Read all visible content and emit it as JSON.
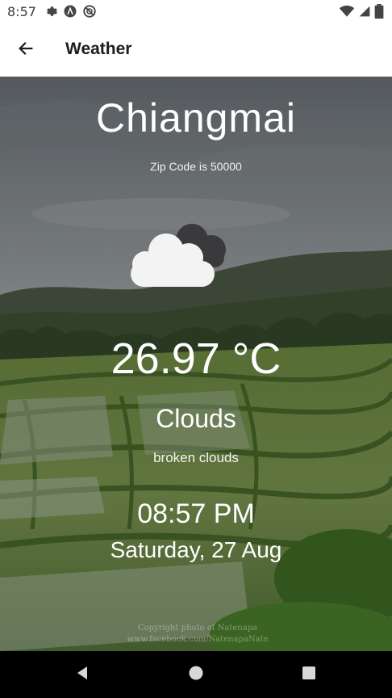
{
  "status_bar": {
    "time": "8:57",
    "left_icons": [
      "settings-icon",
      "a-badge-icon",
      "do-not-disturb-icon"
    ],
    "right_icons": [
      "wifi-icon",
      "cell-signal-icon",
      "battery-icon"
    ]
  },
  "app_bar": {
    "title": "Weather",
    "back_icon": "arrow-back-icon"
  },
  "weather": {
    "city": "Chiangmai",
    "zip_label": "Zip Code is 50000",
    "icon": "broken-clouds-icon",
    "temperature": "26.97 °C",
    "condition": "Clouds",
    "description": "broken clouds",
    "time": "08:57 PM",
    "date": "Saturday, 27 Aug"
  },
  "background": {
    "watermark_line1": "Copyright photo of Natenapa",
    "watermark_line2": "www.facebook.com/NatenapaNate"
  },
  "nav_bar": {
    "back_icon": "nav-back-icon",
    "home_icon": "nav-home-icon",
    "recents_icon": "nav-recents-icon"
  },
  "colors": {
    "accent_text": "#ffffff",
    "app_bar_bg": "#ffffff",
    "nav_bg": "#000000",
    "sky": "#8a9094",
    "field": "#5e7e3a"
  }
}
